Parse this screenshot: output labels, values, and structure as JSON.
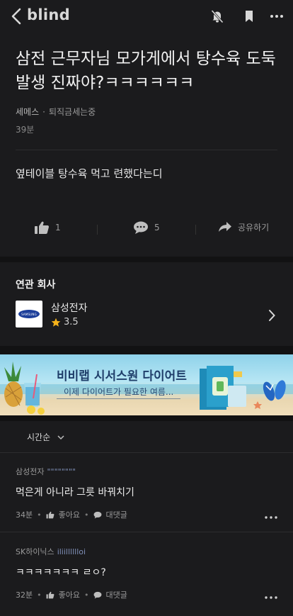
{
  "header": {
    "brand": "blind",
    "icons": [
      "back-chevron-icon",
      "bell-off-icon",
      "bookmark-icon",
      "more-dots-icon"
    ]
  },
  "post": {
    "title": "삼전 근무자님 모가게에서 탕수육 도둑발생 진짜야?ㅋㅋㅋㅋㅋㅋ",
    "company": "세메스",
    "nickname": "퇴직금세는중",
    "time": "39분",
    "body": "옆테이블 탕수육 먹고 련했다는디"
  },
  "actions": {
    "likes": "1",
    "comments": "5",
    "share_label": "공유하기"
  },
  "related": {
    "heading": "연관 회사",
    "company_name": "삼성전자",
    "rating": "3.5",
    "logo_text": "SAMSUNG"
  },
  "banner": {
    "title": "비비랩 시서스원 다이어트",
    "subtitle": "이제 다이어트가 필요한 여름..."
  },
  "sort": {
    "label": "시간순"
  },
  "comments": [
    {
      "company": "삼성전자",
      "nickname": "\"\"\"\"\"\"\"\"",
      "text": "먹은게 아니라 그릇 바꿔치기",
      "time": "34분",
      "like_label": "좋아요",
      "reply_label": "대댓글"
    },
    {
      "company": "SK하이닉스",
      "nickname": "iliilllllloi",
      "text": "ㅋㅋㅋㅋㅋㅋㅋ ㄹㅇ?",
      "time": "32분",
      "like_label": "좋아요",
      "reply_label": "대댓글"
    }
  ],
  "colors": {
    "background": "#1b1b1d",
    "accent_star": "#f5b21a",
    "nick_blue": "#7f8fb7"
  }
}
